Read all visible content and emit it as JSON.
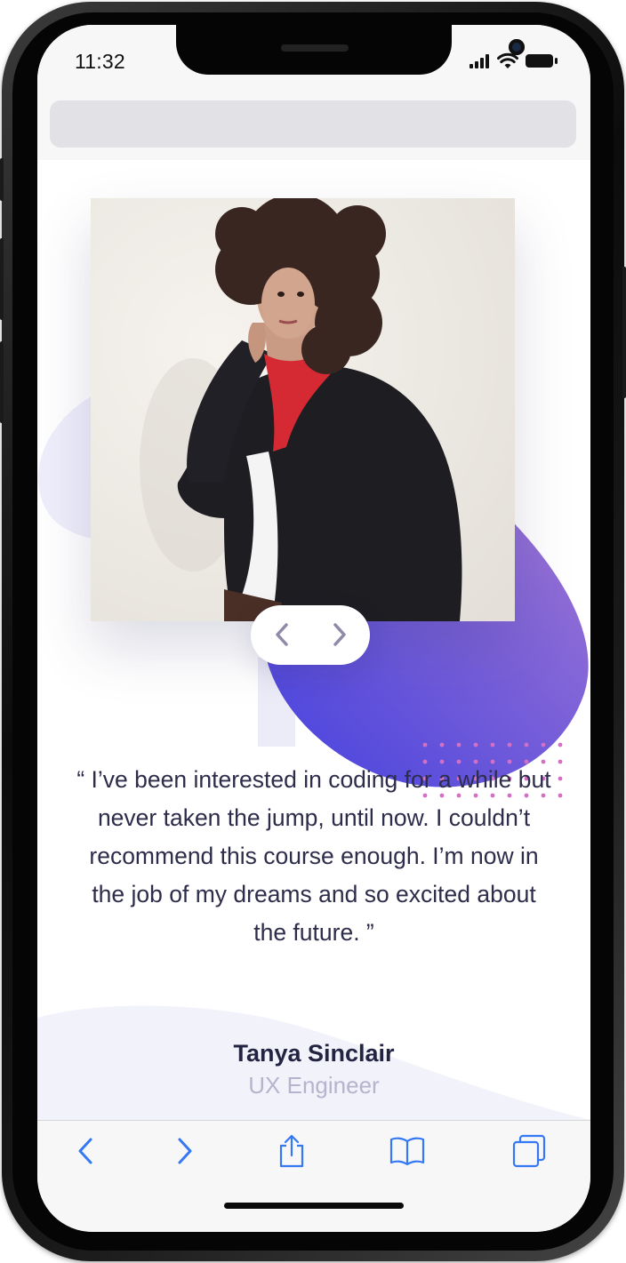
{
  "status_bar": {
    "time": "11:32"
  },
  "testimonial": {
    "quote": "“ I’ve been interested in coding for a while but never taken the jump, until now. I couldn’t recommend this course enough. I’m now in the job of my dreams and so excited about the future. ”",
    "author_name": "Tanya Sinclair",
    "author_role": "UX Engineer"
  },
  "carousel": {
    "prev_icon": "chevron-left-icon",
    "next_icon": "chevron-right-icon"
  },
  "toolbar": {
    "items": [
      "back-icon",
      "forward-icon",
      "share-icon",
      "bookmarks-icon",
      "tabs-icon"
    ]
  },
  "colors": {
    "accent_blue": "#3478f6",
    "text_dark": "#2d2d4b",
    "role_gray": "#b5b4cc",
    "blob_start": "#4f46e5",
    "blob_end": "#9a72d6",
    "light_shape": "#eeeefb",
    "dots": "#d46fc6"
  }
}
